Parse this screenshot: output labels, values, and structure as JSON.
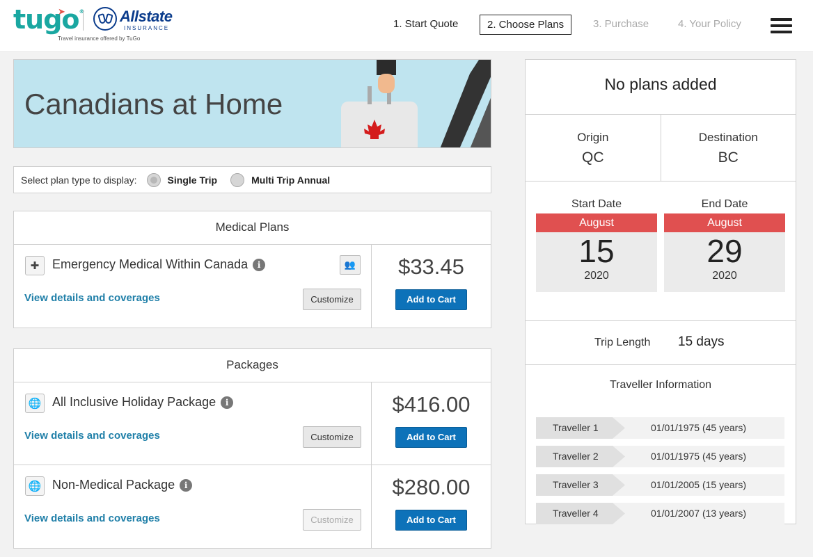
{
  "header": {
    "logo_tugo": "tugo",
    "logo_allstate": "Allstate",
    "logo_insurance": "INSURANCE",
    "tagline": "Travel insurance offered by TuGo",
    "steps": [
      {
        "label": "1. Start Quote",
        "state": "done"
      },
      {
        "label": "2. Choose Plans",
        "state": "active"
      },
      {
        "label": "3. Purchase",
        "state": "disabled"
      },
      {
        "label": "4. Your Policy",
        "state": "disabled"
      }
    ]
  },
  "banner": {
    "title": "Canadians at Home"
  },
  "plan_type": {
    "label": "Select plan type to display:",
    "options": [
      {
        "label": "Single Trip",
        "selected": true
      },
      {
        "label": "Multi Trip Annual",
        "selected": false
      }
    ]
  },
  "medical": {
    "title": "Medical Plans",
    "plans": [
      {
        "name": "Emergency Medical Within Canada",
        "icon": "medical-kit-icon",
        "link": "View details and coverages",
        "customize": "Customize",
        "price": "$33.45",
        "cart": "Add to Cart"
      }
    ]
  },
  "packages": {
    "title": "Packages",
    "plans": [
      {
        "name": "All Inclusive Holiday Package",
        "icon": "globe-plane-icon",
        "link": "View details and coverages",
        "customize": "Customize",
        "price": "$416.00",
        "cart": "Add to Cart"
      },
      {
        "name": "Non-Medical Package",
        "icon": "globe-plane-icon",
        "link": "View details and coverages",
        "customize": "Customize",
        "price": "$280.00",
        "cart": "Add to Cart"
      }
    ]
  },
  "summary": {
    "title": "No plans added",
    "origin_label": "Origin",
    "origin": "QC",
    "destination_label": "Destination",
    "destination": "BC",
    "start": {
      "label": "Start Date",
      "month": "August",
      "day": "15",
      "year": "2020"
    },
    "end": {
      "label": "End Date",
      "month": "August",
      "day": "29",
      "year": "2020"
    },
    "trip_length_label": "Trip Length",
    "trip_length": "15 days",
    "travellers_title": "Traveller Information",
    "travellers": [
      {
        "label": "Traveller 1",
        "dob": "01/01/1975 (45 years)"
      },
      {
        "label": "Traveller 2",
        "dob": "01/01/1975 (45 years)"
      },
      {
        "label": "Traveller 3",
        "dob": "01/01/2005 (15 years)"
      },
      {
        "label": "Traveller 4",
        "dob": "01/01/2007 (13 years)"
      }
    ]
  },
  "colors": {
    "accent_blue": "#0d72b9",
    "link_teal": "#1f7fa8",
    "calendar_red": "#e05050",
    "banner_bg": "#bfe4ef"
  }
}
